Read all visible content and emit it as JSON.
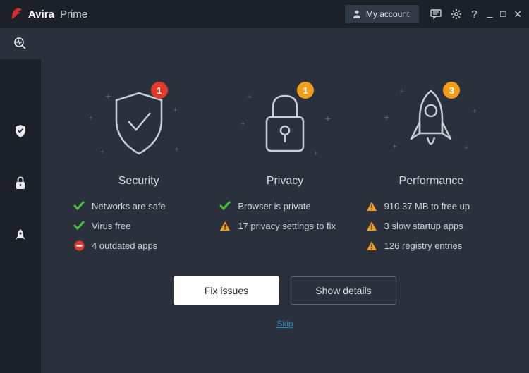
{
  "brand": {
    "name": "Avira",
    "suffix": "Prime"
  },
  "header": {
    "account": "My account"
  },
  "panels": {
    "security": {
      "title": "Security",
      "badge": "1",
      "items": [
        {
          "icon": "ok",
          "text": "Networks are safe"
        },
        {
          "icon": "ok",
          "text": "Virus free"
        },
        {
          "icon": "block",
          "text": "4 outdated apps"
        }
      ]
    },
    "privacy": {
      "title": "Privacy",
      "badge": "1",
      "items": [
        {
          "icon": "ok",
          "text": "Browser is private"
        },
        {
          "icon": "warn",
          "text": "17 privacy settings to fix"
        }
      ]
    },
    "performance": {
      "title": "Performance",
      "badge": "3",
      "items": [
        {
          "icon": "warn",
          "text": "910.37 MB to free up"
        },
        {
          "icon": "warn",
          "text": "3 slow startup apps"
        },
        {
          "icon": "warn",
          "text": "126 registry entries"
        }
      ]
    }
  },
  "buttons": {
    "fix": "Fix issues",
    "details": "Show details",
    "skip": "Skip"
  }
}
